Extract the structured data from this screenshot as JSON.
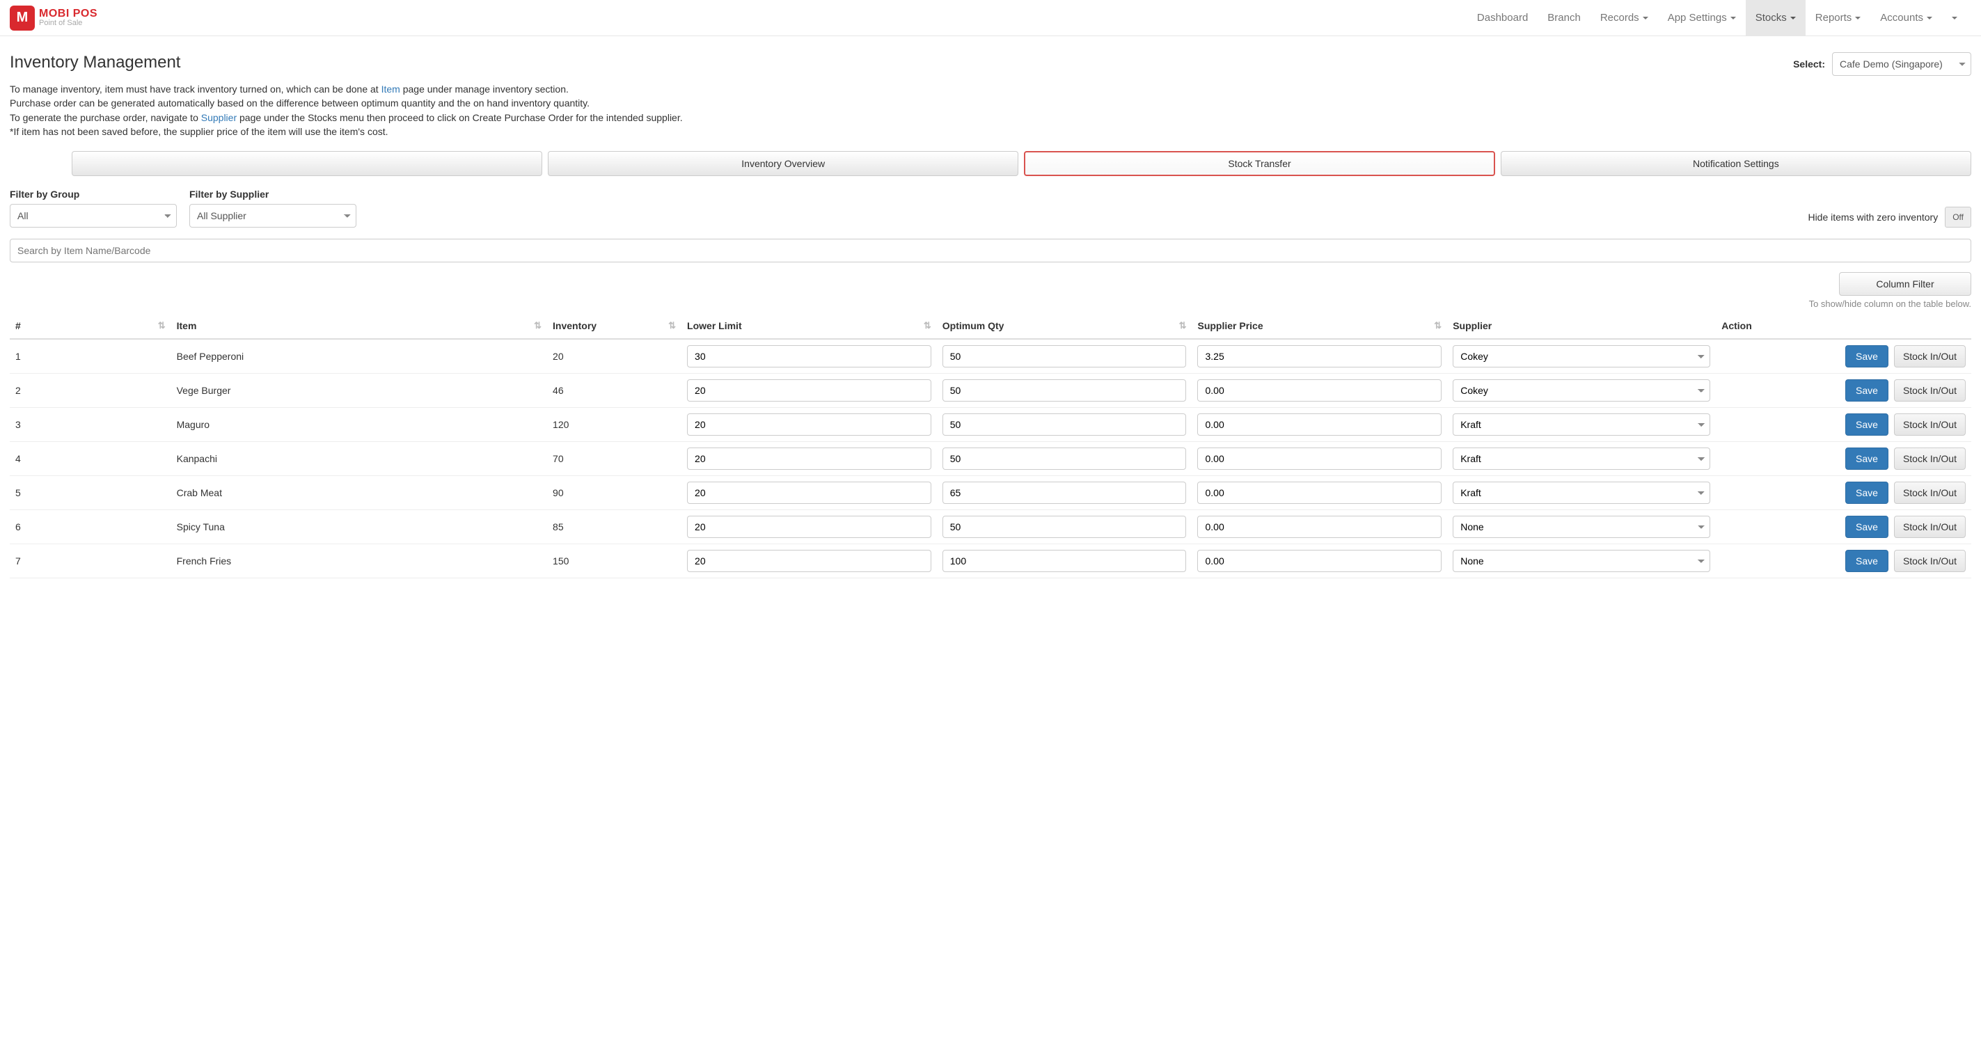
{
  "brand": {
    "logo_letter": "M",
    "title": "MOBI POS",
    "subtitle": "Point of Sale"
  },
  "nav": {
    "dashboard": "Dashboard",
    "branch": "Branch",
    "records": "Records",
    "app_settings": "App Settings",
    "stocks": "Stocks",
    "reports": "Reports",
    "accounts": "Accounts"
  },
  "page": {
    "title": "Inventory Management",
    "select_label": "Select:",
    "location_selected": "Cafe Demo (Singapore)"
  },
  "desc": {
    "line1a": "To manage inventory, item must have track inventory turned on, which can be done at ",
    "link_item": "Item",
    "line1b": " page under manage inventory section.",
    "line2": "Purchase order can be generated automatically based on the difference between optimum quantity and the on hand inventory quantity.",
    "line3a": "To generate the purchase order, navigate to ",
    "link_supplier": "Supplier",
    "line3b": " page under the Stocks menu then proceed to click on Create Purchase Order for the intended supplier.",
    "line4": "*If item has not been saved before, the supplier price of the item will use the item's cost."
  },
  "buttons": {
    "blank": "",
    "inventory_overview": "Inventory Overview",
    "stock_transfer": "Stock Transfer",
    "notification_settings": "Notification Settings",
    "column_filter": "Column Filter",
    "save": "Save",
    "stock_io": "Stock In/Out"
  },
  "filters": {
    "group_label": "Filter by Group",
    "group_value": "All",
    "supplier_label": "Filter by Supplier",
    "supplier_value": "All Supplier",
    "hide_zero_label": "Hide items with zero inventory",
    "toggle_value": "Off",
    "search_placeholder": "Search by Item Name/Barcode"
  },
  "column_filter_hint": "To show/hide column on the table below.",
  "table": {
    "headers": {
      "num": "#",
      "item": "Item",
      "inventory": "Inventory",
      "lower": "Lower Limit",
      "optimum": "Optimum Qty",
      "price": "Supplier Price",
      "supplier": "Supplier",
      "action": "Action"
    },
    "rows": [
      {
        "num": "1",
        "item": "Beef Pepperoni",
        "inventory": "20",
        "lower": "30",
        "optimum": "50",
        "price": "3.25",
        "supplier": "Cokey"
      },
      {
        "num": "2",
        "item": "Vege Burger",
        "inventory": "46",
        "lower": "20",
        "optimum": "50",
        "price": "0.00",
        "supplier": "Cokey"
      },
      {
        "num": "3",
        "item": "Maguro",
        "inventory": "120",
        "lower": "20",
        "optimum": "50",
        "price": "0.00",
        "supplier": "Kraft"
      },
      {
        "num": "4",
        "item": "Kanpachi",
        "inventory": "70",
        "lower": "20",
        "optimum": "50",
        "price": "0.00",
        "supplier": "Kraft"
      },
      {
        "num": "5",
        "item": "Crab Meat",
        "inventory": "90",
        "lower": "20",
        "optimum": "65",
        "price": "0.00",
        "supplier": "Kraft"
      },
      {
        "num": "6",
        "item": "Spicy Tuna",
        "inventory": "85",
        "lower": "20",
        "optimum": "50",
        "price": "0.00",
        "supplier": "None"
      },
      {
        "num": "7",
        "item": "French Fries",
        "inventory": "150",
        "lower": "20",
        "optimum": "100",
        "price": "0.00",
        "supplier": "None"
      }
    ]
  }
}
